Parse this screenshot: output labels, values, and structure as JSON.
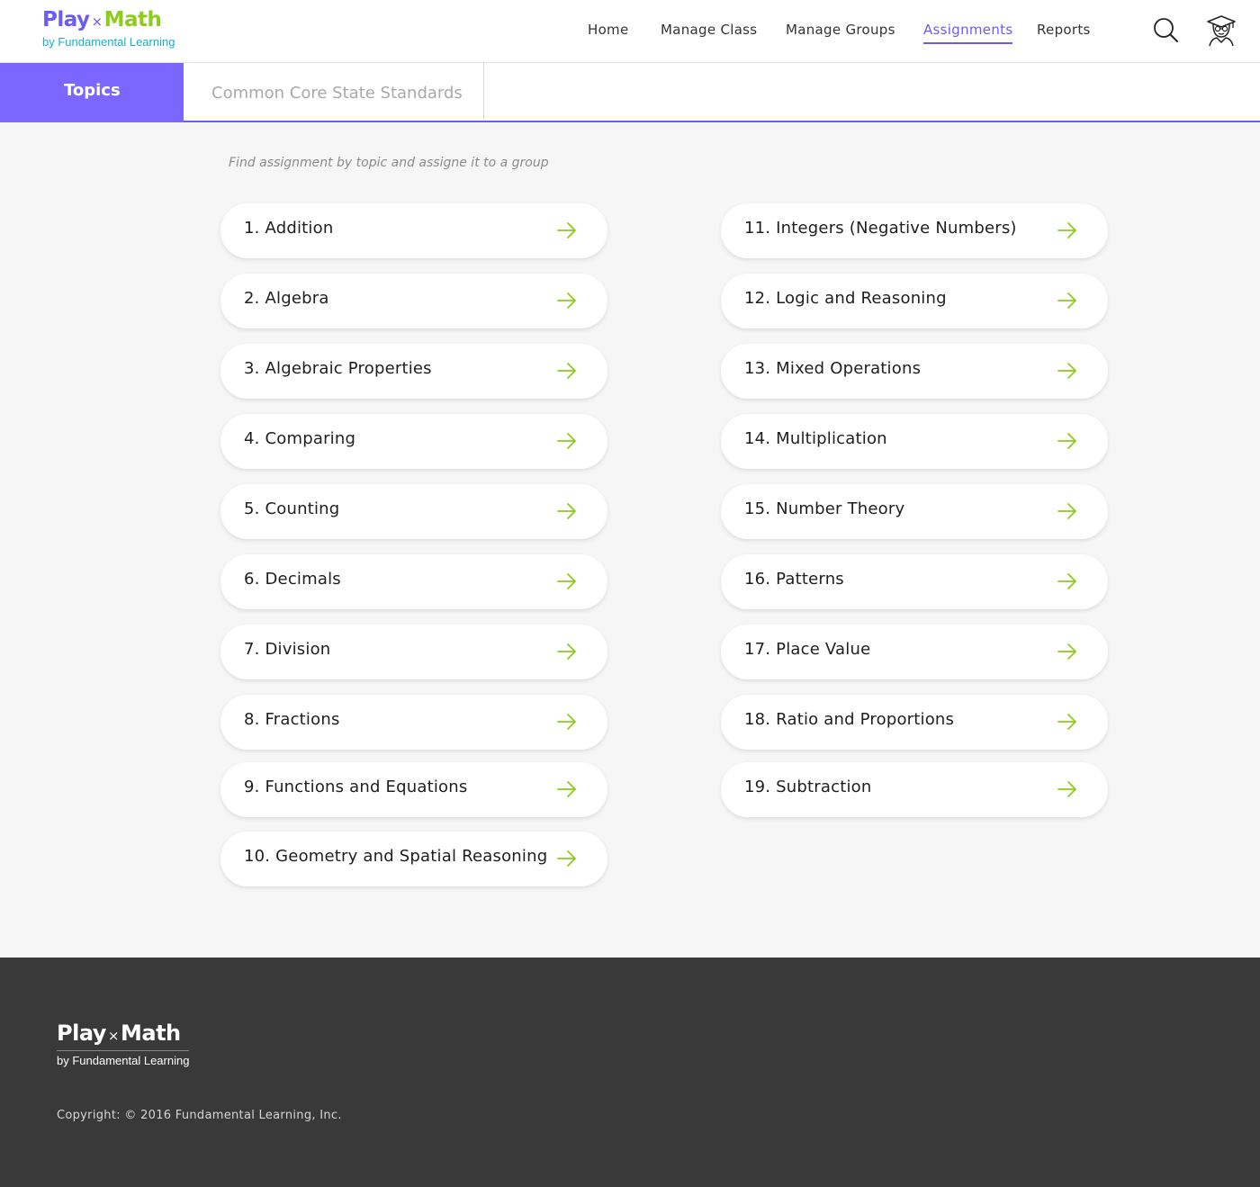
{
  "brand": {
    "play": "Play",
    "x": "×",
    "math": "Math",
    "sub": "by Fundamental Learning"
  },
  "nav": {
    "home": "Home",
    "manage_class": "Manage Class",
    "manage_groups": "Manage Groups",
    "assignments": "Assignments",
    "reports": "Reports",
    "active": "Assignments",
    "search_icon": "search-icon",
    "profile_icon": "graduate-avatar-icon"
  },
  "tabs": {
    "topics": "Topics",
    "ccss": "Common Core State Standards",
    "active": "Topics"
  },
  "main": {
    "instructions": "Find assignment by topic and assigne it to a group",
    "arrow_icon": "arrow-right-icon",
    "topics_left": [
      "1. Addition",
      "2. Algebra",
      "3. Algebraic Properties",
      "4. Comparing",
      "5. Counting",
      "6. Decimals",
      "7. Division",
      "8. Fractions",
      "9. Functions and Equations",
      "10. Geometry and Spatial Reasoning"
    ],
    "topics_right": [
      "11. Integers (Negative Numbers)",
      "12. Logic and Reasoning",
      "13. Mixed Operations",
      "14. Multiplication",
      "15. Number Theory",
      "16. Patterns",
      "17. Place Value",
      "18. Ratio and Proportions",
      "19. Subtraction"
    ]
  },
  "footer": {
    "play": "Play",
    "x": "×",
    "math": "Math",
    "sub": "by Fundamental Learning",
    "copyright": "Copyright: © 2016 Fundamental Learning, Inc."
  },
  "colors": {
    "accent": "#6a5cf5",
    "tab_active": "#7b66ff",
    "brand_green": "#8ccc1a",
    "brand_teal": "#16b1c9",
    "arrow": "#8ccc1a",
    "footer_bg": "#393939"
  }
}
